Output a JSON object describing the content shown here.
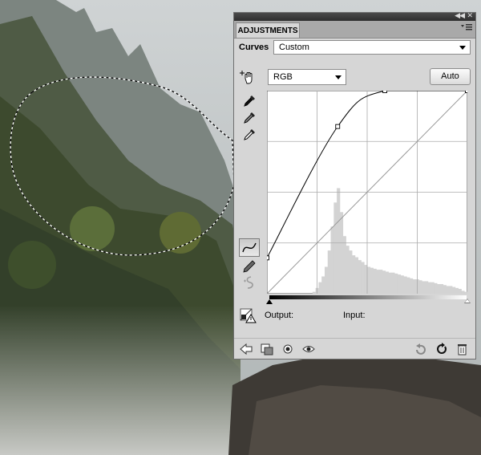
{
  "panel": {
    "tab_title": "ADJUSTMENTS",
    "curves_label": "Curves",
    "preset_value": "Custom",
    "channel_value": "RGB",
    "auto_label": "Auto",
    "output_label": "Output:",
    "input_label": "Input:"
  },
  "icons": {
    "titlebar": [
      "collapse-double-arrow-icon",
      "close-icon"
    ],
    "menu": "panel-menu-icon",
    "left_tools": [
      "hand-adjust-icon",
      "black-point-eyedropper-icon",
      "gray-point-eyedropper-icon",
      "white-point-eyedropper-icon",
      "curve-points-icon",
      "pencil-draw-icon",
      "smooth-curve-icon"
    ],
    "clipping_warning": "clipping-warning-icon",
    "footer": [
      "back-arrow-icon",
      "clip-to-layer-icon",
      "toggle-visibility-eye-icon",
      "view-previous-eye-icon",
      "reset-icon",
      "refresh-icon",
      "trash-icon"
    ]
  },
  "chart_data": {
    "type": "line",
    "xlim": [
      0,
      255
    ],
    "ylim": [
      0,
      255
    ],
    "grid": true,
    "series": [
      {
        "x": [
          0,
          90,
          150,
          255
        ],
        "y": [
          45,
          210,
          255,
          255
        ]
      }
    ],
    "histogram_bins": [
      0,
      0,
      0,
      0,
      0,
      0,
      0,
      0,
      0,
      0,
      0,
      0,
      0,
      0,
      0,
      2,
      6,
      12,
      18,
      28,
      45,
      70,
      95,
      110,
      85,
      60,
      50,
      45,
      40,
      38,
      35,
      33,
      30,
      28,
      27,
      26,
      25,
      25,
      24,
      23,
      22,
      22,
      21,
      20,
      19,
      18,
      17,
      16,
      15,
      15,
      14,
      13,
      13,
      12,
      12,
      11,
      10,
      10,
      9,
      8,
      8,
      7,
      6,
      5,
      3,
      2
    ]
  }
}
